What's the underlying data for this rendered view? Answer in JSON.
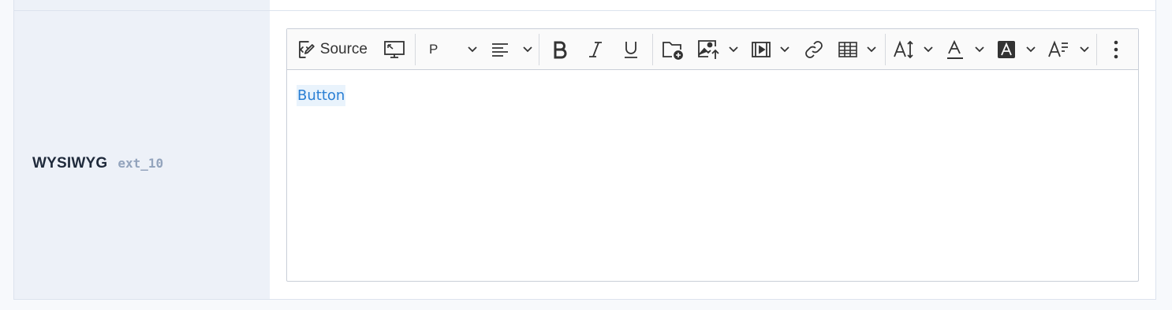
{
  "field": {
    "name": "WYSIWYG",
    "code": "ext_10"
  },
  "toolbar": {
    "source_label": "Source",
    "heading_value": "P",
    "icons": [
      "source-icon",
      "fullscreen-icon",
      "paragraph-format",
      "align-icon",
      "bold-icon",
      "italic-icon",
      "underline-icon",
      "file-manager-icon",
      "insert-image-icon",
      "insert-media-icon",
      "link-icon",
      "table-icon",
      "font-size-icon",
      "font-color-icon",
      "highlight-icon",
      "text-style-icon",
      "more-icon"
    ]
  },
  "content": {
    "button_text": "Button"
  },
  "colors": {
    "label_bg": "#edf1f8",
    "link": "#2a7fd4",
    "link_bg": "#e9f3fc"
  }
}
